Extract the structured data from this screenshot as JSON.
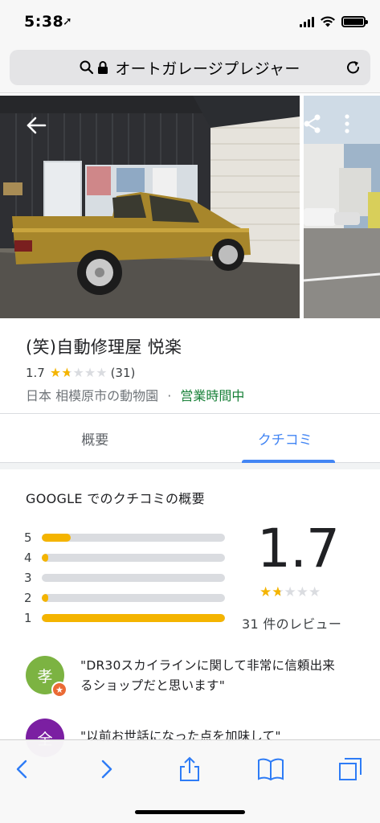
{
  "status_bar": {
    "time": "5:38",
    "location_glyph": "➚"
  },
  "url_bar": {
    "title": "オートガレージプレジャー"
  },
  "place": {
    "name": "(笑)自動修理屋 悦楽",
    "rating": "1.7",
    "rating_value": 1.7,
    "review_count_paren": "(31)",
    "address": "日本 相模原市の動物園",
    "separator": "·",
    "open_status": "営業時間中"
  },
  "tabs": [
    {
      "label": "概要",
      "active": false
    },
    {
      "label": "クチコミ",
      "active": true
    }
  ],
  "reviews_overview": {
    "heading": "GOOGLE でのクチコミの概要",
    "average": "1.7",
    "average_value": 1.7,
    "count_text": "31 件のレビュー",
    "distribution": [
      {
        "stars": "5",
        "fraction": 0.16
      },
      {
        "stars": "4",
        "fraction": 0.04
      },
      {
        "stars": "3",
        "fraction": 0.0
      },
      {
        "stars": "2",
        "fraction": 0.04
      },
      {
        "stars": "1",
        "fraction": 1.0
      }
    ]
  },
  "reviews": [
    {
      "avatar_letter": "孝",
      "avatar_color": "#7cb342",
      "local_guide": true,
      "text_line1": "\"DR30スカイラインに関して非常に信頼出来",
      "text_line2": "るショップだと思います\""
    },
    {
      "avatar_letter": "全",
      "avatar_color": "#7b1fa2",
      "local_guide": false,
      "text_line1": "\"以前お世話になった点を加味して\"",
      "text_line2": ""
    }
  ],
  "colors": {
    "accent": "#4285f4",
    "star": "#f4b400",
    "open": "#188038"
  },
  "icons": {
    "back": "back-arrow-icon",
    "share": "share-icon",
    "more": "more-vert-icon",
    "search": "search-icon",
    "lock": "lock-icon",
    "reload": "reload-icon",
    "browser_back": "chevron-left-icon",
    "browser_forward": "chevron-right-icon",
    "share_sheet": "share-sheet-icon",
    "bookmarks": "bookmarks-icon",
    "tabs": "tabs-icon"
  }
}
